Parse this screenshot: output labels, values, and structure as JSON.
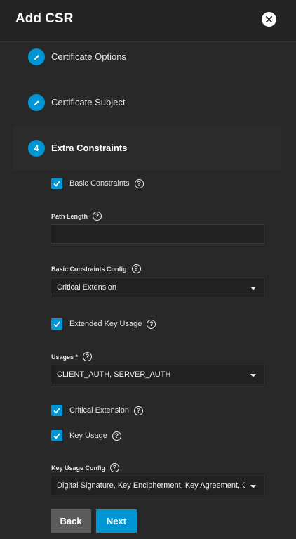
{
  "dialog": {
    "title": "Add CSR"
  },
  "steps": [
    {
      "label": "Certificate Options",
      "badge": "pencil-icon"
    },
    {
      "label": "Certificate Subject",
      "badge": "pencil-icon"
    },
    {
      "label": "Extra Constraints",
      "number": "4"
    }
  ],
  "form": {
    "basic_constraints": {
      "label": "Basic Constraints",
      "checked": true
    },
    "path_length": {
      "label": "Path Length",
      "value": ""
    },
    "basic_constraints_config": {
      "label": "Basic Constraints Config",
      "value": "Critical Extension"
    },
    "extended_key_usage": {
      "label": "Extended Key Usage",
      "checked": true
    },
    "usages": {
      "label": "Usages *",
      "value": "CLIENT_AUTH, SERVER_AUTH"
    },
    "critical_extension": {
      "label": "Critical Extension",
      "checked": true
    },
    "key_usage": {
      "label": "Key Usage",
      "checked": true
    },
    "key_usage_config": {
      "label": "Key Usage Config",
      "value": "Digital Signature, Key Encipherment, Key Agreement, C..."
    }
  },
  "buttons": {
    "back": "Back",
    "next": "Next"
  },
  "colors": {
    "accent": "#0095d5",
    "background": "#282828",
    "back_button": "#5c5c5c"
  }
}
